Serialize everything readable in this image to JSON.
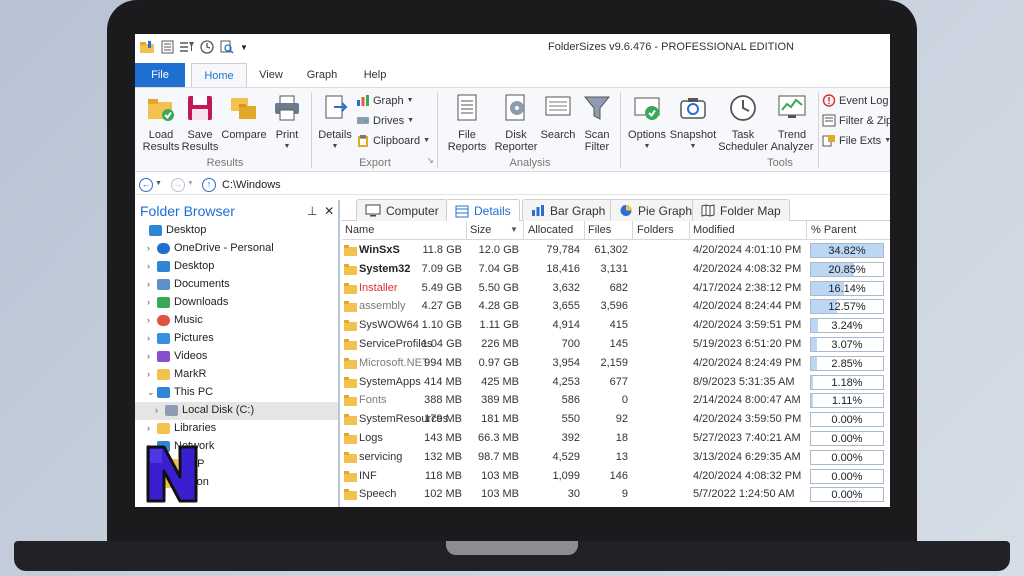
{
  "app": {
    "title": "FolderSizes v9.6.476 - PROFESSIONAL EDITION"
  },
  "menu": {
    "tabs": [
      "File",
      "Home",
      "View",
      "Graph",
      "Help"
    ],
    "active": "Home"
  },
  "ribbon": {
    "results": {
      "load": "Load Results",
      "save": "Save Results",
      "compare": "Compare",
      "print": "Print",
      "label": "Results"
    },
    "export": {
      "details": "Details",
      "graph": "Graph",
      "drives": "Drives",
      "clipboard": "Clipboard",
      "label": "Export"
    },
    "analysis": {
      "file_reports": "File Reports",
      "disk_reporter": "Disk Reporter",
      "search": "Search",
      "scan_filter": "Scan Filter",
      "label": "Analysis"
    },
    "tools": {
      "options": "Options",
      "snapshot": "Snapshot",
      "task_scheduler": "Task Scheduler",
      "trend_analyzer": "Trend Analyzer",
      "event_log": "Event Log",
      "filter_zip": "Filter & Zip",
      "file_exts": "File Exts",
      "label": "Tools"
    }
  },
  "address": {
    "path": "C:\\Windows"
  },
  "browser": {
    "title": "Folder Browser",
    "items": [
      {
        "label": "Desktop",
        "icon": "desktop-icon",
        "level": 0,
        "arrow": ""
      },
      {
        "label": "OneDrive - Personal",
        "icon": "onedrive-icon",
        "level": 1,
        "arrow": ">"
      },
      {
        "label": "Desktop",
        "icon": "desktop-icon",
        "level": 1,
        "arrow": ">"
      },
      {
        "label": "Documents",
        "icon": "documents-icon",
        "level": 1,
        "arrow": ">"
      },
      {
        "label": "Downloads",
        "icon": "downloads-icon",
        "level": 1,
        "arrow": ">"
      },
      {
        "label": "Music",
        "icon": "music-icon",
        "level": 1,
        "arrow": ">"
      },
      {
        "label": "Pictures",
        "icon": "pictures-icon",
        "level": 1,
        "arrow": ">"
      },
      {
        "label": "Videos",
        "icon": "videos-icon",
        "level": 1,
        "arrow": ">"
      },
      {
        "label": "MarkR",
        "icon": "folder-icon",
        "level": 1,
        "arrow": ">"
      },
      {
        "label": "This PC",
        "icon": "pc-icon",
        "level": 1,
        "arrow": "v"
      },
      {
        "label": "Local Disk (C:)",
        "icon": "drive-icon",
        "level": 2,
        "arrow": ">"
      },
      {
        "label": "Libraries",
        "icon": "folder-icon",
        "level": 1,
        "arrow": ">"
      },
      {
        "label": "Network",
        "icon": "network-icon",
        "level": 1,
        "arrow": ">"
      },
      {
        "label": "TOP",
        "icon": "folder-icon",
        "level": 2,
        "arrow": ""
      },
      {
        "label": "tation",
        "icon": "folder-icon",
        "level": 2,
        "arrow": ""
      }
    ]
  },
  "view_tabs": [
    "Computer",
    "Details",
    "Bar Graph",
    "Pie Graph",
    "Folder Map"
  ],
  "table": {
    "columns": [
      "Name",
      "Size",
      "Allocated",
      "Files",
      "Folders",
      "Modified",
      "% Parent"
    ],
    "rows": [
      {
        "name": "WinSxS",
        "size": "11.8 GB",
        "allocated": "12.0 GB",
        "files": "79,784",
        "folders": "61,302",
        "modified": "4/20/2024 4:01:10 PM",
        "parent": "34.82%",
        "pct": 34.82,
        "style": "bold"
      },
      {
        "name": "System32",
        "size": "7.09 GB",
        "allocated": "7.04 GB",
        "files": "18,416",
        "folders": "3,131",
        "modified": "4/20/2024 4:08:32 PM",
        "parent": "20.85%",
        "pct": 20.85,
        "style": "bold"
      },
      {
        "name": "Installer",
        "size": "5.49 GB",
        "allocated": "5.50 GB",
        "files": "3,632",
        "folders": "682",
        "modified": "4/17/2024 2:38:12 PM",
        "parent": "16.14%",
        "pct": 16.14,
        "style": "red"
      },
      {
        "name": "assembly",
        "size": "4.27 GB",
        "allocated": "4.28 GB",
        "files": "3,655",
        "folders": "3,596",
        "modified": "4/20/2024 8:24:44 PM",
        "parent": "12.57%",
        "pct": 12.57,
        "style": "grey"
      },
      {
        "name": "SysWOW64",
        "size": "1.10 GB",
        "allocated": "1.11 GB",
        "files": "4,914",
        "folders": "415",
        "modified": "4/20/2024 3:59:51 PM",
        "parent": "3.24%",
        "pct": 3.24,
        "style": "normal"
      },
      {
        "name": "ServiceProfiles",
        "size": "1.04 GB",
        "allocated": "226 MB",
        "files": "700",
        "folders": "145",
        "modified": "5/19/2023 6:51:20 PM",
        "parent": "3.07%",
        "pct": 3.07,
        "style": "normal"
      },
      {
        "name": "Microsoft.NET",
        "size": "994 MB",
        "allocated": "0.97 GB",
        "files": "3,954",
        "folders": "2,159",
        "modified": "4/20/2024 8:24:49 PM",
        "parent": "2.85%",
        "pct": 2.85,
        "style": "grey"
      },
      {
        "name": "SystemApps",
        "size": "414 MB",
        "allocated": "425 MB",
        "files": "4,253",
        "folders": "677",
        "modified": "8/9/2023 5:31:35 AM",
        "parent": "1.18%",
        "pct": 1.18,
        "style": "normal"
      },
      {
        "name": "Fonts",
        "size": "388 MB",
        "allocated": "389 MB",
        "files": "586",
        "folders": "0",
        "modified": "2/14/2024 8:00:47 AM",
        "parent": "1.11%",
        "pct": 1.11,
        "style": "grey"
      },
      {
        "name": "SystemResources",
        "size": "179 MB",
        "allocated": "181 MB",
        "files": "550",
        "folders": "92",
        "modified": "4/20/2024 3:59:50 PM",
        "parent": "0.00%",
        "pct": 0,
        "style": "normal"
      },
      {
        "name": "Logs",
        "size": "143 MB",
        "allocated": "66.3 MB",
        "files": "392",
        "folders": "18",
        "modified": "5/27/2023 7:40:21 AM",
        "parent": "0.00%",
        "pct": 0,
        "style": "normal"
      },
      {
        "name": "servicing",
        "size": "132 MB",
        "allocated": "98.7 MB",
        "files": "4,529",
        "folders": "13",
        "modified": "3/13/2024 6:29:35 AM",
        "parent": "0.00%",
        "pct": 0,
        "style": "normal"
      },
      {
        "name": "INF",
        "size": "118 MB",
        "allocated": "103 MB",
        "files": "1,099",
        "folders": "146",
        "modified": "4/20/2024 4:08:32 PM",
        "parent": "0.00%",
        "pct": 0,
        "style": "normal"
      },
      {
        "name": "Speech",
        "size": "102 MB",
        "allocated": "103 MB",
        "files": "30",
        "folders": "9",
        "modified": "5/7/2022 1:24:50 AM",
        "parent": "0.00%",
        "pct": 0,
        "style": "normal"
      }
    ]
  },
  "logo": {
    "letter": "N"
  },
  "colors": {
    "accent": "#1f6fd1",
    "folder": "#f2c14e",
    "bar_fill": "#bcd7f3",
    "red_text": "#e03030",
    "grey_text": "#7a7a7a",
    "logo_fill": "#3a1fd0"
  }
}
